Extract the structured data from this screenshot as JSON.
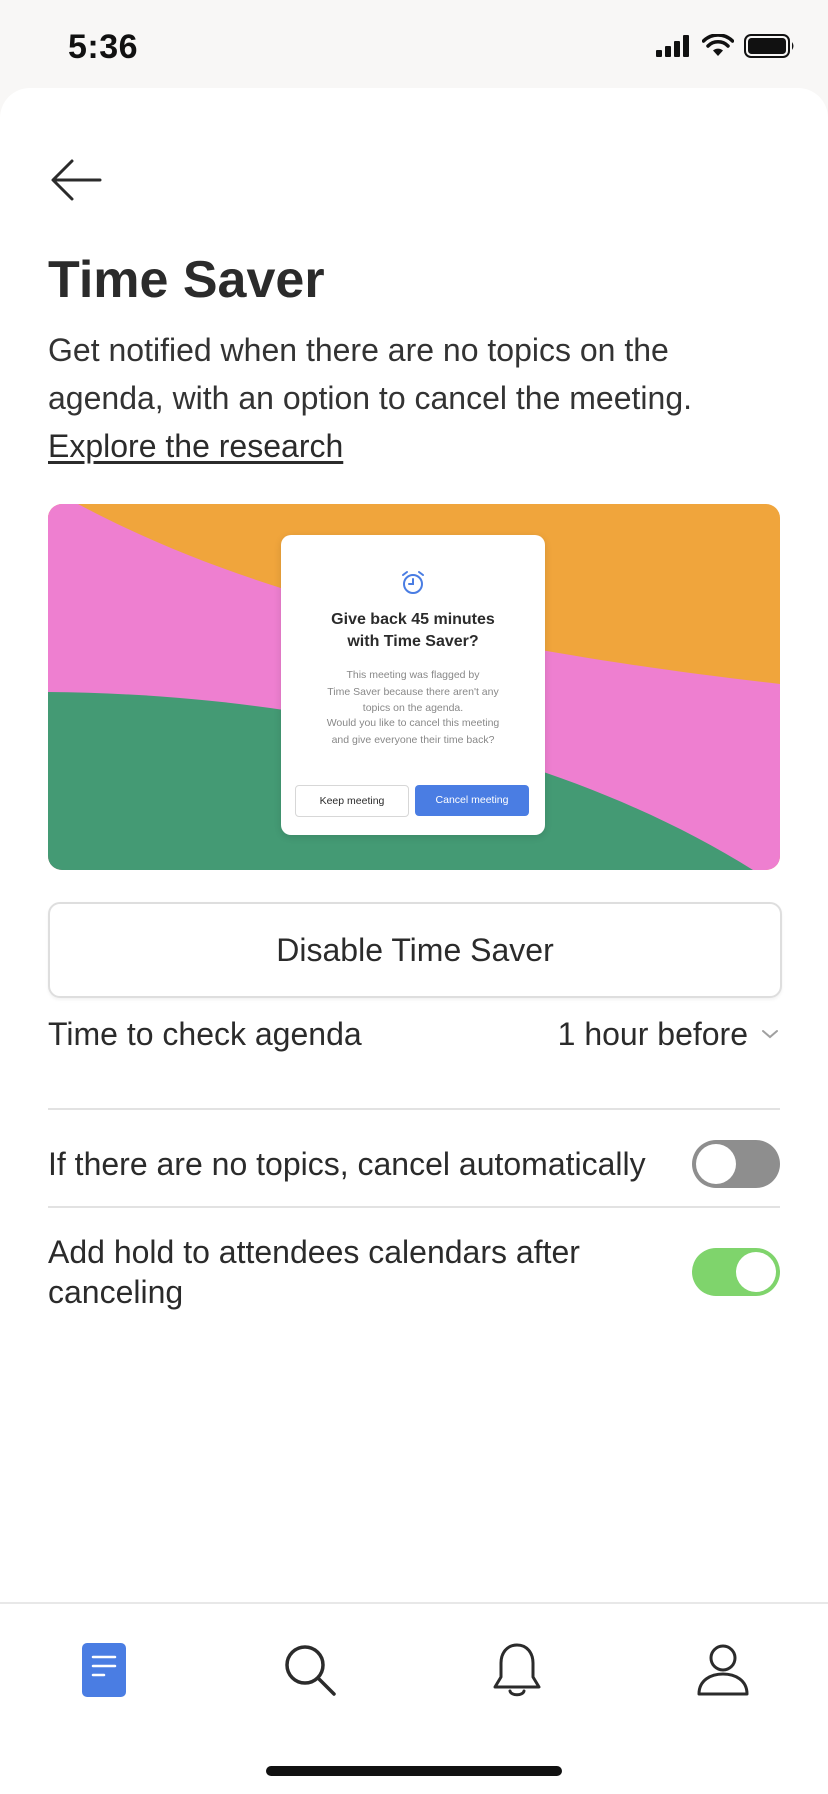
{
  "status_bar": {
    "time": "5:36"
  },
  "page": {
    "title": "Time Saver",
    "description": "Get notified when there are no topics on the agenda, with an option to cancel the meeting.",
    "research_link": "Explore the research"
  },
  "illustration": {
    "colors": {
      "orange": "#f0a53c",
      "pink": "#ee7fd0",
      "green": "#449a74"
    },
    "modal": {
      "icon": "alarm-clock-icon",
      "title_line1": "Give back 45 minutes",
      "title_line2": "with Time Saver?",
      "body1_line1": "This meeting was flagged by",
      "body1_line2": "Time Saver because there aren't any",
      "body1_line3": "topics on the agenda.",
      "body2_line1": "Would you like to cancel this meeting",
      "body2_line2": "and give everyone their time back?",
      "keep_label": "Keep meeting",
      "cancel_label": "Cancel meeting"
    }
  },
  "disable_button": {
    "label": "Disable Time Saver"
  },
  "settings": {
    "check_time": {
      "label": "Time to check agenda",
      "value": "1 hour before"
    },
    "auto_cancel": {
      "label": "If there are no topics, cancel automatically",
      "enabled": false
    },
    "add_hold": {
      "label_line1": "Add hold to attendees calendars after",
      "label_line2": "canceling",
      "enabled": true
    }
  },
  "tab_bar": {
    "items": [
      {
        "icon": "document-icon",
        "active": true
      },
      {
        "icon": "search-icon",
        "active": false
      },
      {
        "icon": "bell-icon",
        "active": false
      },
      {
        "icon": "profile-icon",
        "active": false
      }
    ],
    "accent": "#4a7de3"
  }
}
